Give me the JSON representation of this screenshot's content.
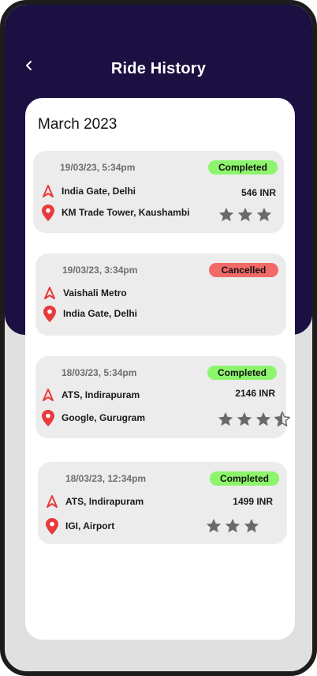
{
  "header": {
    "title": "Ride History",
    "back_icon": "chevron-left-icon"
  },
  "colors": {
    "header_bg": "#1c1042",
    "completed": "#8df56c",
    "cancelled": "#f26a68",
    "pin": "#e83a3a",
    "star": "#6a6a6a"
  },
  "month_label": "March 2023",
  "rides": [
    {
      "datetime": "19/03/23, 5:34pm",
      "status": "Completed",
      "pickup": "India Gate, Delhi",
      "drop": "KM Trade Tower, Kaushambi",
      "fare": "546 INR",
      "rating": 3
    },
    {
      "datetime": "19/03/23, 3:34pm",
      "status": "Cancelled",
      "pickup": "Vaishali Metro",
      "drop": "India Gate, Delhi",
      "fare": "",
      "rating": 0
    },
    {
      "datetime": "18/03/23, 5:34pm",
      "status": "Completed",
      "pickup": "ATS, Indirapuram",
      "drop": "Google, Gurugram",
      "fare": "2146 INR",
      "rating": 3.5
    },
    {
      "datetime": "18/03/23, 12:34pm",
      "status": "Completed",
      "pickup": "ATS, Indirapuram",
      "drop": "IGI, Airport",
      "fare": "1499 INR",
      "rating": 3
    }
  ]
}
